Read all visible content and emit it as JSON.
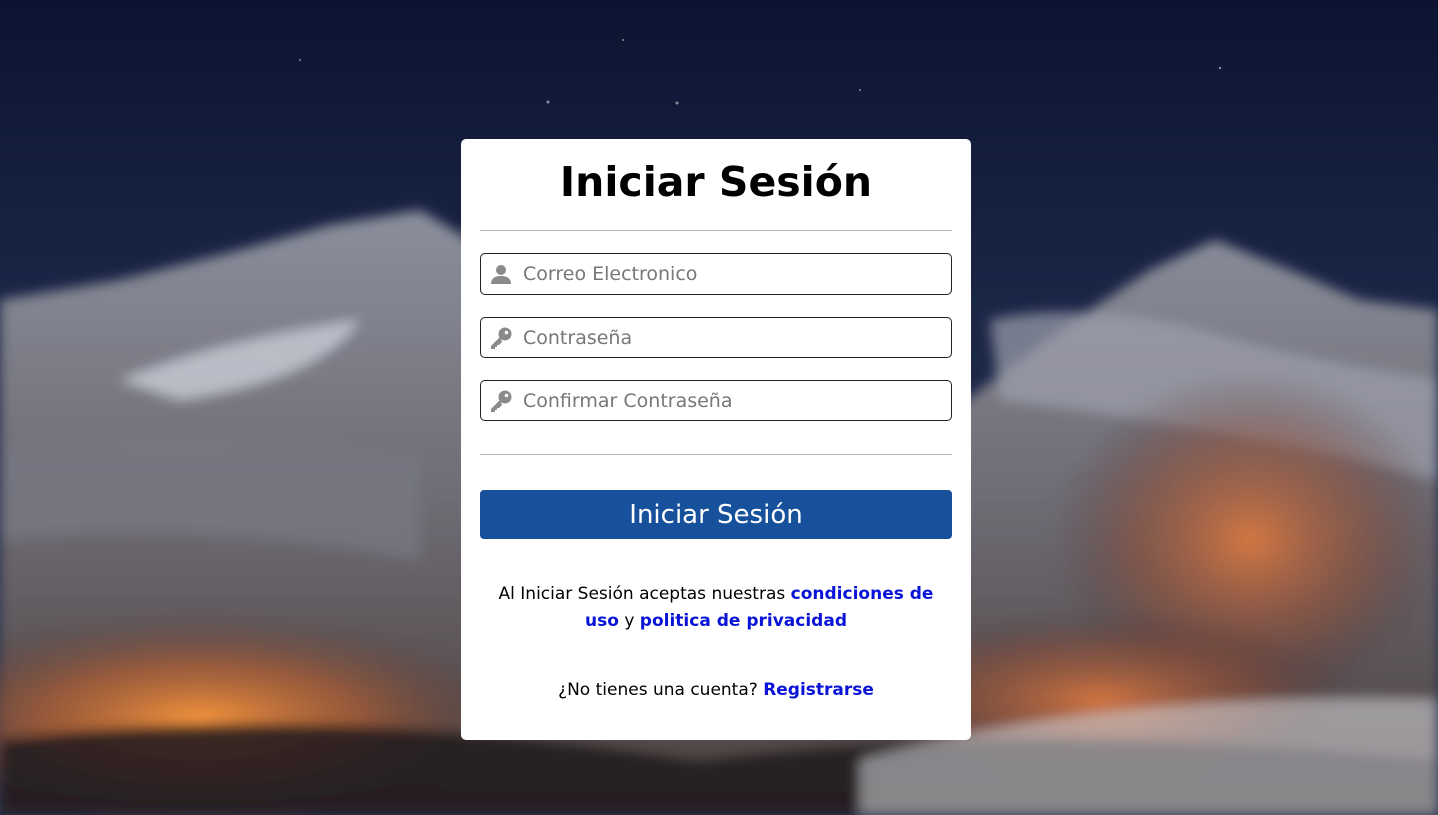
{
  "title": "Iniciar Sesión",
  "fields": {
    "email_placeholder": "Correo Electronico",
    "password_placeholder": "Contraseña",
    "confirm_placeholder": "Confirmar Contraseña"
  },
  "submit_label": "Iniciar Sesión",
  "terms": {
    "prefix": "Al Iniciar Sesión aceptas nuestras ",
    "conditions_link": "condiciones de uso",
    "conjunction": " y ",
    "privacy_link": "politica de privacidad"
  },
  "register": {
    "prompt": "¿No tienes una cuenta? ",
    "link": "Registrarse"
  },
  "icons": {
    "email": "user-icon",
    "password": "key-icon",
    "confirm": "key-icon"
  },
  "colors": {
    "button": "#17519c",
    "link": "#0a14d6",
    "card": "#ffffff"
  }
}
